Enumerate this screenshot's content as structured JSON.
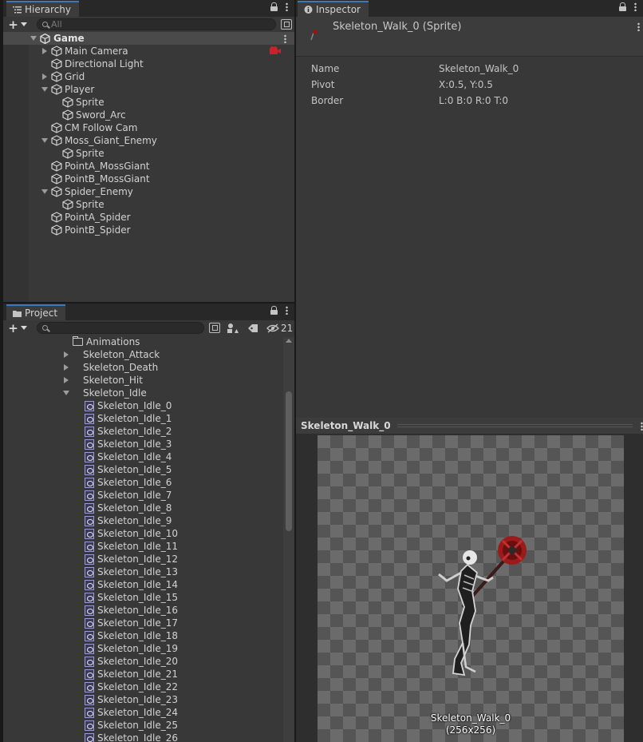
{
  "hierarchy": {
    "tab_label": "Hierarchy",
    "search_placeholder": "All",
    "scene_name": "Game",
    "items": [
      {
        "label": "Main Camera",
        "depth": 0,
        "fold": "right"
      },
      {
        "label": "Directional Light",
        "depth": 0,
        "fold": "none"
      },
      {
        "label": "Grid",
        "depth": 0,
        "fold": "right"
      },
      {
        "label": "Player",
        "depth": 0,
        "fold": "down"
      },
      {
        "label": "Sprite",
        "depth": 1,
        "fold": "none"
      },
      {
        "label": "Sword_Arc",
        "depth": 1,
        "fold": "none"
      },
      {
        "label": "CM Follow Cam",
        "depth": 0,
        "fold": "none"
      },
      {
        "label": "Moss_Giant_Enemy",
        "depth": 0,
        "fold": "down"
      },
      {
        "label": "Sprite",
        "depth": 1,
        "fold": "none"
      },
      {
        "label": "PointA_MossGiant",
        "depth": 0,
        "fold": "none"
      },
      {
        "label": "PointB_MossGiant",
        "depth": 0,
        "fold": "none"
      },
      {
        "label": "Spider_Enemy",
        "depth": 0,
        "fold": "down"
      },
      {
        "label": "Sprite",
        "depth": 1,
        "fold": "none"
      },
      {
        "label": "PointA_Spider",
        "depth": 0,
        "fold": "none"
      },
      {
        "label": "PointB_Spider",
        "depth": 0,
        "fold": "none"
      }
    ]
  },
  "project": {
    "tab_label": "Project",
    "search_value": "",
    "hidden_count": "21",
    "folder": "Animations",
    "sub_items": [
      {
        "label": "Skeleton_Attack",
        "fold": "right"
      },
      {
        "label": "Skeleton_Death",
        "fold": "right"
      },
      {
        "label": "Skeleton_Hit",
        "fold": "right"
      },
      {
        "label": "Skeleton_Idle",
        "fold": "down"
      }
    ],
    "sprites": [
      "Skeleton_Idle_0",
      "Skeleton_Idle_1",
      "Skeleton_Idle_2",
      "Skeleton_Idle_3",
      "Skeleton_Idle_4",
      "Skeleton_Idle_5",
      "Skeleton_Idle_6",
      "Skeleton_Idle_7",
      "Skeleton_Idle_8",
      "Skeleton_Idle_9",
      "Skeleton_Idle_10",
      "Skeleton_Idle_11",
      "Skeleton_Idle_12",
      "Skeleton_Idle_13",
      "Skeleton_Idle_14",
      "Skeleton_Idle_15",
      "Skeleton_Idle_16",
      "Skeleton_Idle_17",
      "Skeleton_Idle_18",
      "Skeleton_Idle_19",
      "Skeleton_Idle_20",
      "Skeleton_Idle_21",
      "Skeleton_Idle_22",
      "Skeleton_Idle_23",
      "Skeleton_Idle_24",
      "Skeleton_Idle_25",
      "Skeleton_Idle_26"
    ]
  },
  "inspector": {
    "tab_label": "Inspector",
    "title": "Skeleton_Walk_0 (Sprite)",
    "fields": [
      {
        "key": "Name",
        "value": "Skeleton_Walk_0"
      },
      {
        "key": "Pivot",
        "value": "X:0.5, Y:0.5"
      },
      {
        "key": "Border",
        "value": "L:0 B:0 R:0 T:0"
      }
    ],
    "preview_title": "Skeleton_Walk_0",
    "preview_caption_name": "Skeleton_Walk_0",
    "preview_caption_size": "(256x256)"
  },
  "colors": {
    "tab_accent": "#3a79bb",
    "panel_bg": "#383838",
    "scene_row_bg": "#4a4a4a"
  }
}
